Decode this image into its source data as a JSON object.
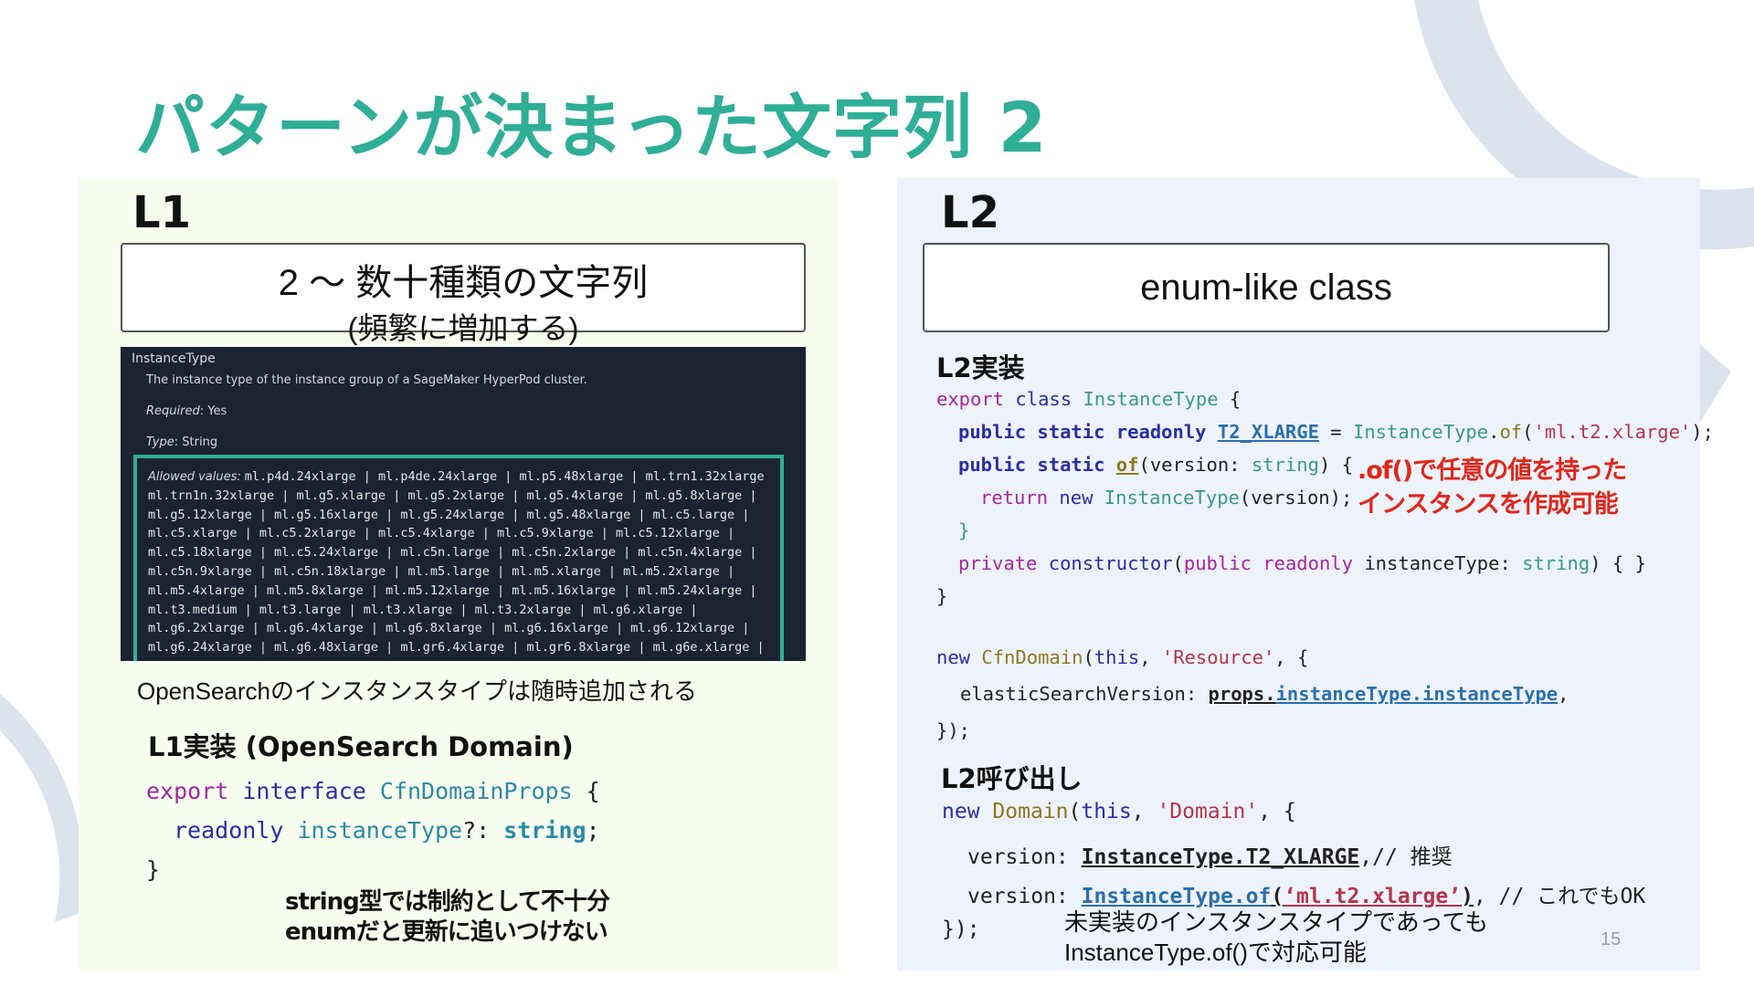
{
  "title": "パターンが決まった文字列 2",
  "page_number": "15",
  "l1": {
    "heading": "L1",
    "box_line1": "2 〜 数十種類の文字列",
    "box_line2": "(頻繁に増加する)",
    "doc": {
      "param_name": "InstanceType",
      "description": "The instance type of the instance group of a SageMaker HyperPod cluster.",
      "required_label": "Required",
      "required_value": ": Yes",
      "type_label": "Type",
      "type_value": ": String",
      "allowed_label": "Allowed values:",
      "allowed_lines": [
        "ml.p4d.24xlarge | ml.p4de.24xlarge | ml.p5.48xlarge | ml.trn1.32xlarge",
        "ml.trn1n.32xlarge | ml.g5.xlarge | ml.g5.2xlarge | ml.g5.4xlarge | ml.g5.8xlarge |",
        "ml.g5.12xlarge | ml.g5.16xlarge | ml.g5.24xlarge | ml.g5.48xlarge | ml.c5.large |",
        "ml.c5.xlarge | ml.c5.2xlarge | ml.c5.4xlarge | ml.c5.9xlarge | ml.c5.12xlarge |",
        "ml.c5.18xlarge | ml.c5.24xlarge | ml.c5n.large | ml.c5n.2xlarge | ml.c5n.4xlarge |",
        "ml.c5n.9xlarge | ml.c5n.18xlarge | ml.m5.large | ml.m5.xlarge | ml.m5.2xlarge |",
        "ml.m5.4xlarge | ml.m5.8xlarge | ml.m5.12xlarge | ml.m5.16xlarge | ml.m5.24xlarge |",
        "ml.t3.medium | ml.t3.large | ml.t3.xlarge | ml.t3.2xlarge | ml.g6.xlarge |",
        "ml.g6.2xlarge | ml.g6.4xlarge | ml.g6.8xlarge | ml.g6.16xlarge | ml.g6.12xlarge |",
        "ml.g6.24xlarge | ml.g6.48xlarge | ml.gr6.4xlarge | ml.gr6.8xlarge | ml.g6e.xlarge |"
      ]
    },
    "caption": "OpenSearchのインスタンスタイプは随時追加される",
    "impl_heading": "L1実装 (OpenSearch Domain)",
    "code": {
      "l1_export": "export",
      "l1_interface": "interface",
      "l1_name": "CfnDomainProps",
      "l1_brace": " {",
      "l2_readonly": "readonly",
      "l2_prop": "instanceType",
      "l2_opt": "?: ",
      "l2_type": "string",
      "l2_semi": ";",
      "l3_close": "}"
    },
    "note_line1": "string型では制約として不十分",
    "note_line2": "enumだと更新に追いつけない"
  },
  "l2": {
    "heading": "L2",
    "box_text": "enum-like class",
    "impl_heading": "L2実装",
    "code": {
      "c1_export": "export",
      "c1_class": "class",
      "c1_name": "InstanceType",
      "c1_brace": " {",
      "c2_mods": "public static readonly",
      "c2_const": "T2_XLARGE",
      "c2_eq": " = ",
      "c2_cls": "InstanceType",
      "c2_dot": ".",
      "c2_of": "of",
      "c2_open": "(",
      "c2_str": "'ml.t2.xlarge'",
      "c2_end": ");",
      "c3_mods": "public static",
      "c3_of": "of",
      "c3_param": "(version: ",
      "c3_type": "string",
      "c3_end": ") {",
      "c4_return": "return",
      "c4_new": "new",
      "c4_cls": "InstanceType",
      "c4_end": "(version);",
      "c5_close": "}",
      "c6_private": "private",
      "c6_ctor": "constructor",
      "c6_open": "(",
      "c6_public": "public readonly",
      "c6_param": " instanceType: ",
      "c6_type": "string",
      "c6_end": ") { }",
      "c7_close": "}",
      "c8_new": "new",
      "c8_cls": "CfnDomain",
      "c8_open": "(",
      "c8_this": "this",
      "c8_comma": ", ",
      "c8_str": "'Resource'",
      "c8_end": ", {",
      "c9_key": "elasticSearchVersion: ",
      "c9_props": "props.",
      "c9_chain": "instanceType.instanceType",
      "c9_comma": ",",
      "c10_close": "});"
    },
    "red_note_line1": ".of()で任意の値を持った",
    "red_note_line2": "インスタンスを作成可能",
    "call_heading": "L2呼び出し",
    "call": {
      "d1_new": "new",
      "d1_cls": "Domain",
      "d1_open": "(",
      "d1_this": "this",
      "d1_comma": ", ",
      "d1_str": "'Domain'",
      "d1_end": ", {",
      "d2_key": "version: ",
      "d2_val": "InstanceType.T2_XLARGE",
      "d2_comment": ",// 推奨",
      "d3_key": "version: ",
      "d3_cls": "InstanceType.of",
      "d3_open": "(",
      "d3_str": "‘ml.t2.xlarge’",
      "d3_close": ")",
      "d3_comment": ", // これでもOK",
      "d4_close": "});"
    },
    "bottom_note_line1": "未実装のインスタンスタイプであっても",
    "bottom_note_line2": "InstanceType.of()で対応可能"
  }
}
